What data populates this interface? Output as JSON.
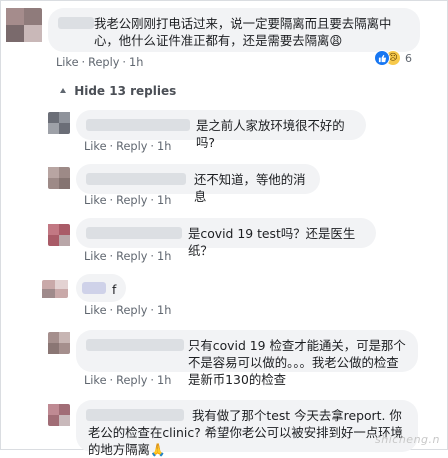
{
  "thread": {
    "main_comment": {
      "text": "我老公刚刚打电话过来，说一定要隔离而且要去隔离中心，他什么证件准正都有，还是需要去隔离😩",
      "actions": {
        "like": "Like",
        "reply": "Reply",
        "time": "1h"
      },
      "reaction_count": "6"
    },
    "hide_replies_label": "Hide 13 replies",
    "replies": [
      {
        "text": "是之前人家放环境很不好的吗?",
        "like": "Like",
        "reply": "Reply",
        "time": "1h"
      },
      {
        "text": "还不知道，等他的消息",
        "like": "Like",
        "reply": "Reply",
        "time": "1h"
      },
      {
        "text": "是covid 19 test吗？还是医生纸？",
        "like": "Like",
        "reply": "Reply",
        "time": "1h"
      },
      {
        "text": "f",
        "like": "Like",
        "reply": "Reply",
        "time": "1h"
      },
      {
        "text": "只有covid 19 检查才能通关，可是那个不是容易可以做的。。。我老公做的检查是新币130的检查",
        "like": "Like",
        "reply": "Reply",
        "time": "1h"
      },
      {
        "text": "我有做了那个test 今天去拿report. 你老公的检查在clinic? 希望你老公可以被安排到好一点环境的地方隔离🙏"
      }
    ]
  },
  "watermark": "shicheng.n",
  "colors": {
    "bubble": "#f2f3f5",
    "meta": "#606770",
    "like_blue": "#1877f2"
  },
  "icons": {
    "like": "like-reaction-icon",
    "sad": "sad-reaction-icon",
    "arrow": "collapse-arrow-icon"
  }
}
